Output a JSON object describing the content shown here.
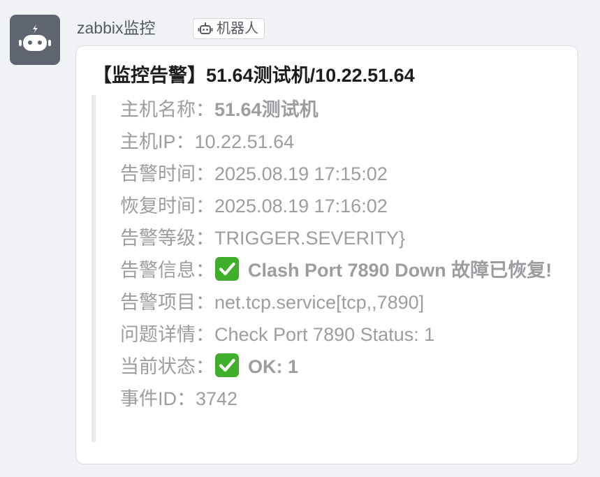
{
  "sender": {
    "name": "zabbix监控",
    "badge_label": "机器人",
    "avatar_icon": "robot-icon",
    "badge_icon": "robot-icon"
  },
  "message": {
    "title": "【监控告警】51.64测试机/10.22.51.64",
    "fields": [
      {
        "key": "host_name",
        "label": "主机名称：",
        "value": "51.64测试机"
      },
      {
        "key": "host_ip",
        "label": "主机IP：",
        "value": "10.22.51.64"
      },
      {
        "key": "alert_time",
        "label": "告警时间：",
        "value": "2025.08.19 17:15:02"
      },
      {
        "key": "recovery_time",
        "label": "恢复时间：",
        "value": "2025.08.19 17:16:02"
      },
      {
        "key": "alert_level",
        "label": "告警等级：",
        "value": "TRIGGER.SEVERITY}"
      },
      {
        "key": "alert_info",
        "label": "告警信息：",
        "value": "Clash Port 7890 Down 故障已恢复!",
        "icon": "check-mark-icon"
      },
      {
        "key": "alert_item",
        "label": "告警项目：",
        "value": "net.tcp.service[tcp,,7890]"
      },
      {
        "key": "problem_detail",
        "label": "问题详情：",
        "value": "Check Port 7890 Status: 1"
      },
      {
        "key": "current_status",
        "label": "当前状态：",
        "value": "OK: 1",
        "icon": "check-mark-icon"
      },
      {
        "key": "event_id",
        "label": "事件ID：",
        "value": "3742"
      }
    ]
  },
  "colors": {
    "check_green": "#3fae2a",
    "avatar_bg": "#5e656e"
  }
}
